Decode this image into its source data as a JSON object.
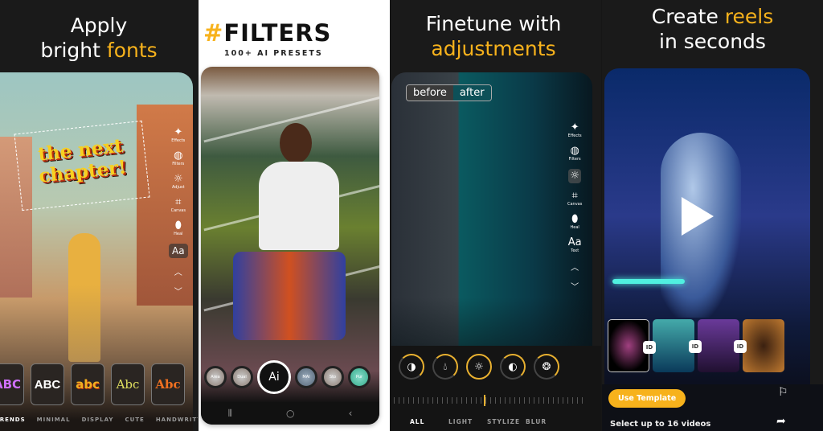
{
  "colors": {
    "accent": "#f7b21c",
    "dark": "#1a1a1a"
  },
  "panel1": {
    "title_line1": "Apply",
    "title_plain": "bright ",
    "title_accent": "fonts",
    "overlay_text_line1": "the next",
    "overlay_text_line2": "chapter!",
    "tools": [
      {
        "icon": "effects-icon",
        "label": "Effects"
      },
      {
        "icon": "filters-icon",
        "label": "Filters"
      },
      {
        "icon": "adjust-icon",
        "label": "Adjust"
      },
      {
        "icon": "canvas-icon",
        "label": "Canvas"
      },
      {
        "icon": "heal-icon",
        "label": "Heal"
      }
    ],
    "text_tool": "Aa",
    "styles": [
      "ABC",
      "ABC",
      "abc",
      "Abc",
      "Abc"
    ],
    "style_tabs": [
      "TRENDS",
      "MINIMAL",
      "DISPLAY",
      "CUTE",
      "HANDWRITTTEN"
    ]
  },
  "panel2": {
    "title_hash": "#",
    "title": "FILTERS",
    "subtitle": "100+ AI PRESETS",
    "ai_button": "Ai",
    "chips": [
      "Area",
      "Dual",
      "MAI",
      "Sto",
      "Pur"
    ],
    "nav": [
      "recents-icon",
      "home-icon",
      "back-icon"
    ]
  },
  "panel3": {
    "title_line1": "Finetune with",
    "title_accent": "adjustments",
    "before": "before",
    "after": "after",
    "tools": [
      {
        "icon": "effects-icon",
        "label": "Effects"
      },
      {
        "icon": "filters-icon",
        "label": "Filters"
      },
      {
        "icon": "adjust-icon",
        "label": ""
      },
      {
        "icon": "canvas-icon",
        "label": "Canvas"
      },
      {
        "icon": "heal-icon",
        "label": "Heal"
      },
      {
        "icon": "text-icon",
        "label": "Text"
      }
    ],
    "text_tool": "Aa",
    "dials": [
      "exposure-icon",
      "saturation-icon",
      "brightness-icon",
      "contrast-icon",
      "aperture-icon"
    ],
    "tabs": [
      "ALL",
      "LIGHT",
      "STYLIZE",
      "BLUR"
    ],
    "active_tab": "ALL"
  },
  "panel4": {
    "title_plain": "Create ",
    "title_accent": "reels",
    "title_line2": "in seconds",
    "use_template": "Use Template",
    "select_text": "Select up to 16 videos",
    "transition_label": "ID"
  }
}
